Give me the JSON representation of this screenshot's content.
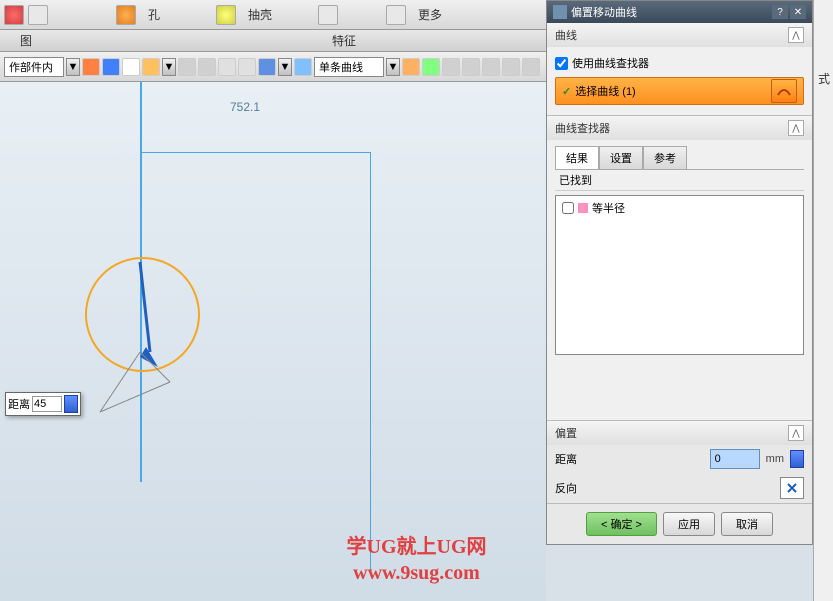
{
  "top_toolbar": {
    "hole_label": "孔",
    "pull_label": "抽壳",
    "more2_label": "更多"
  },
  "tabs": {
    "left_label": "图",
    "center_label": "特征"
  },
  "toolbar2": {
    "scope_label": "作部件内",
    "curve_label": "单条曲线"
  },
  "canvas": {
    "dim1": "752.1",
    "float_label": "距离",
    "float_value": "45"
  },
  "panel": {
    "title": "偏置移动曲线",
    "section_curve": "曲线",
    "checkbox_finder": "使用曲线查找器",
    "select_curve": "选择曲线 (1)",
    "section_finder": "曲线查找器",
    "tab_result": "结果",
    "tab_settings": "设置",
    "tab_reference": "参考",
    "found_label": "已找到",
    "list_item1": "等半径",
    "section_offset": "偏置",
    "distance_label": "距离",
    "distance_value": "0",
    "distance_unit": "mm",
    "reverse_label": "反向",
    "btn_ok": "< 确定 >",
    "btn_apply": "应用",
    "btn_cancel": "取消"
  },
  "side": {
    "char1": "式"
  },
  "watermark": {
    "line1": "学UG就上UG网",
    "line2": "www.9sug.com"
  }
}
